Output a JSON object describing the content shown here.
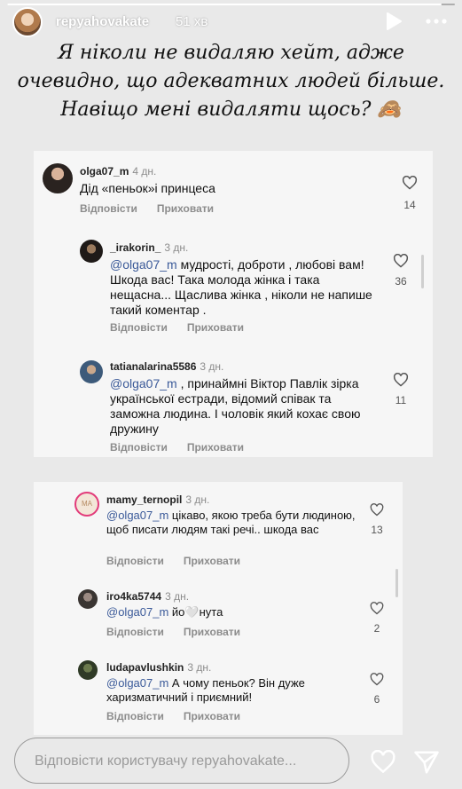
{
  "story": {
    "progress_fraction": 0.97,
    "username": "repyahovakate",
    "time_ago": "51 хв",
    "icons": {
      "play": "play-icon",
      "more": "more-dots-icon",
      "close": "close-icon"
    }
  },
  "caption": {
    "lines": [
      "Я ніколи не видаляю хейт, адже",
      "очевидно, що адекватних людей більше.",
      "Навіщо мені видаляти щось? 🙈"
    ]
  },
  "comments": [
    {
      "username": "olga07_m",
      "time": "4 дн.",
      "text": "Дід «пеньок»і принцеса",
      "reply": "Відповісти",
      "hide": "Приховати",
      "likes": "14"
    },
    {
      "username": "_irakorin_",
      "time": "3 дн.",
      "mention": "@olga07_m",
      "text": " мудрості, доброти , любові вам! Шкода вас! Така молода жінка і така нещасна... Щаслива жінка , ніколи не напише такий коментар .",
      "reply": "Відповісти",
      "hide": "Приховати",
      "likes": "36"
    },
    {
      "username": "tatianalarina5586",
      "time": "3 дн.",
      "mention": "@olga07_m",
      "text": " , принаймні Віктор Павлік зірка української естради, відомий співак та заможна людина. І чоловік який кохає свою дружину",
      "reply": "Відповісти",
      "hide": "Приховати",
      "likes": "11"
    },
    {
      "username": "mamy_ternopil",
      "time": "3 дн.",
      "mention": "@olga07_m",
      "text": " цікаво, якою треба бути людиною, щоб писати людям такі речі.. шкода вас",
      "reply": "Відповісти",
      "hide": "Приховати",
      "likes": "13",
      "avatar_text": "MA"
    },
    {
      "username": "iro4ka5744",
      "time": "3 дн.",
      "mention": "@olga07_m",
      "text": " йо🤍нута",
      "reply": "Відповісти",
      "hide": "Приховати",
      "likes": "2"
    },
    {
      "username": "ludapavlushkin",
      "time": "3 дн.",
      "mention": "@olga07_m",
      "text": " А чому пеньок? Він дуже харизматичний і приємний!",
      "reply": "Відповісти",
      "hide": "Приховати",
      "likes": "6"
    }
  ],
  "reply_bar": {
    "placeholder": "Відповісти користувачу repyahovakate..."
  },
  "colors": {
    "background": "#e9e9e9",
    "card": "#f6f6f6",
    "mention": "#3b5a99",
    "muted": "#8c8c8c"
  }
}
